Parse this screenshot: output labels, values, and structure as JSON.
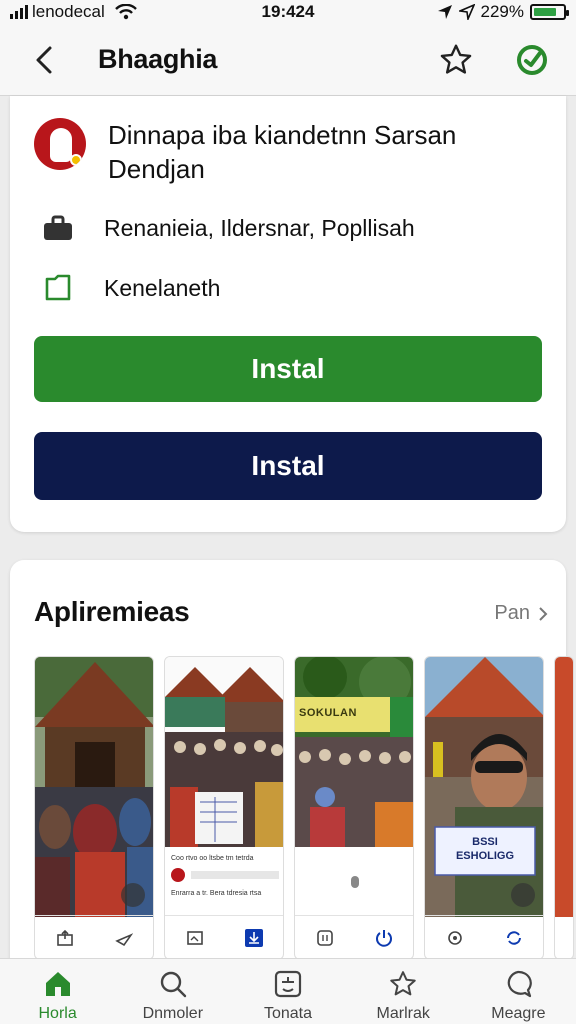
{
  "status_bar": {
    "carrier": "lenodecal",
    "time": "19:424",
    "battery_percent": "229%",
    "battery_level": 0.8,
    "icons": [
      "signal-icon",
      "wifi-icon",
      "location-arrow-icon",
      "battery-icon"
    ]
  },
  "header": {
    "title": "Bhaaghia",
    "icons": [
      "back-chevron-icon",
      "star-icon",
      "refresh-icon"
    ]
  },
  "app": {
    "name": "Dinnapa iba kiandetnn Sarsan Dendjan",
    "publisher": "Renanieia, Ildersnar, Popllisah",
    "category": "Kenelaneth",
    "primary_button": "Instal",
    "secondary_button": "Instal",
    "colors": {
      "primary": "#2a8a2d",
      "secondary": "#0d1a4b",
      "logo": "#b8161b"
    }
  },
  "screenshots": {
    "title": "Apliremieas",
    "see_more": "Pan",
    "items": [
      {
        "label": "traditional-house-crowd"
      },
      {
        "label": "crowd-with-form",
        "caption_line1": "Coo rtvo oo ltsbe tm tetrda",
        "caption_line2": "Enrarra a tr. Bera tdresia rtsa"
      },
      {
        "label": "crowd-with-banner",
        "banner": "SOKULAN"
      },
      {
        "label": "man-holding-card",
        "card_line1": "BSSI",
        "card_line2": "ESHOLIGG"
      }
    ]
  },
  "bottom_nav": {
    "items": [
      {
        "label": "Horla",
        "icon": "home-icon",
        "active": true
      },
      {
        "label": "Dnmoler",
        "icon": "search-icon",
        "active": false
      },
      {
        "label": "Tonata",
        "icon": "apps-icon",
        "active": false
      },
      {
        "label": "Marlrak",
        "icon": "star-icon",
        "active": false
      },
      {
        "label": "Meagre",
        "icon": "chat-icon",
        "active": false
      }
    ]
  }
}
